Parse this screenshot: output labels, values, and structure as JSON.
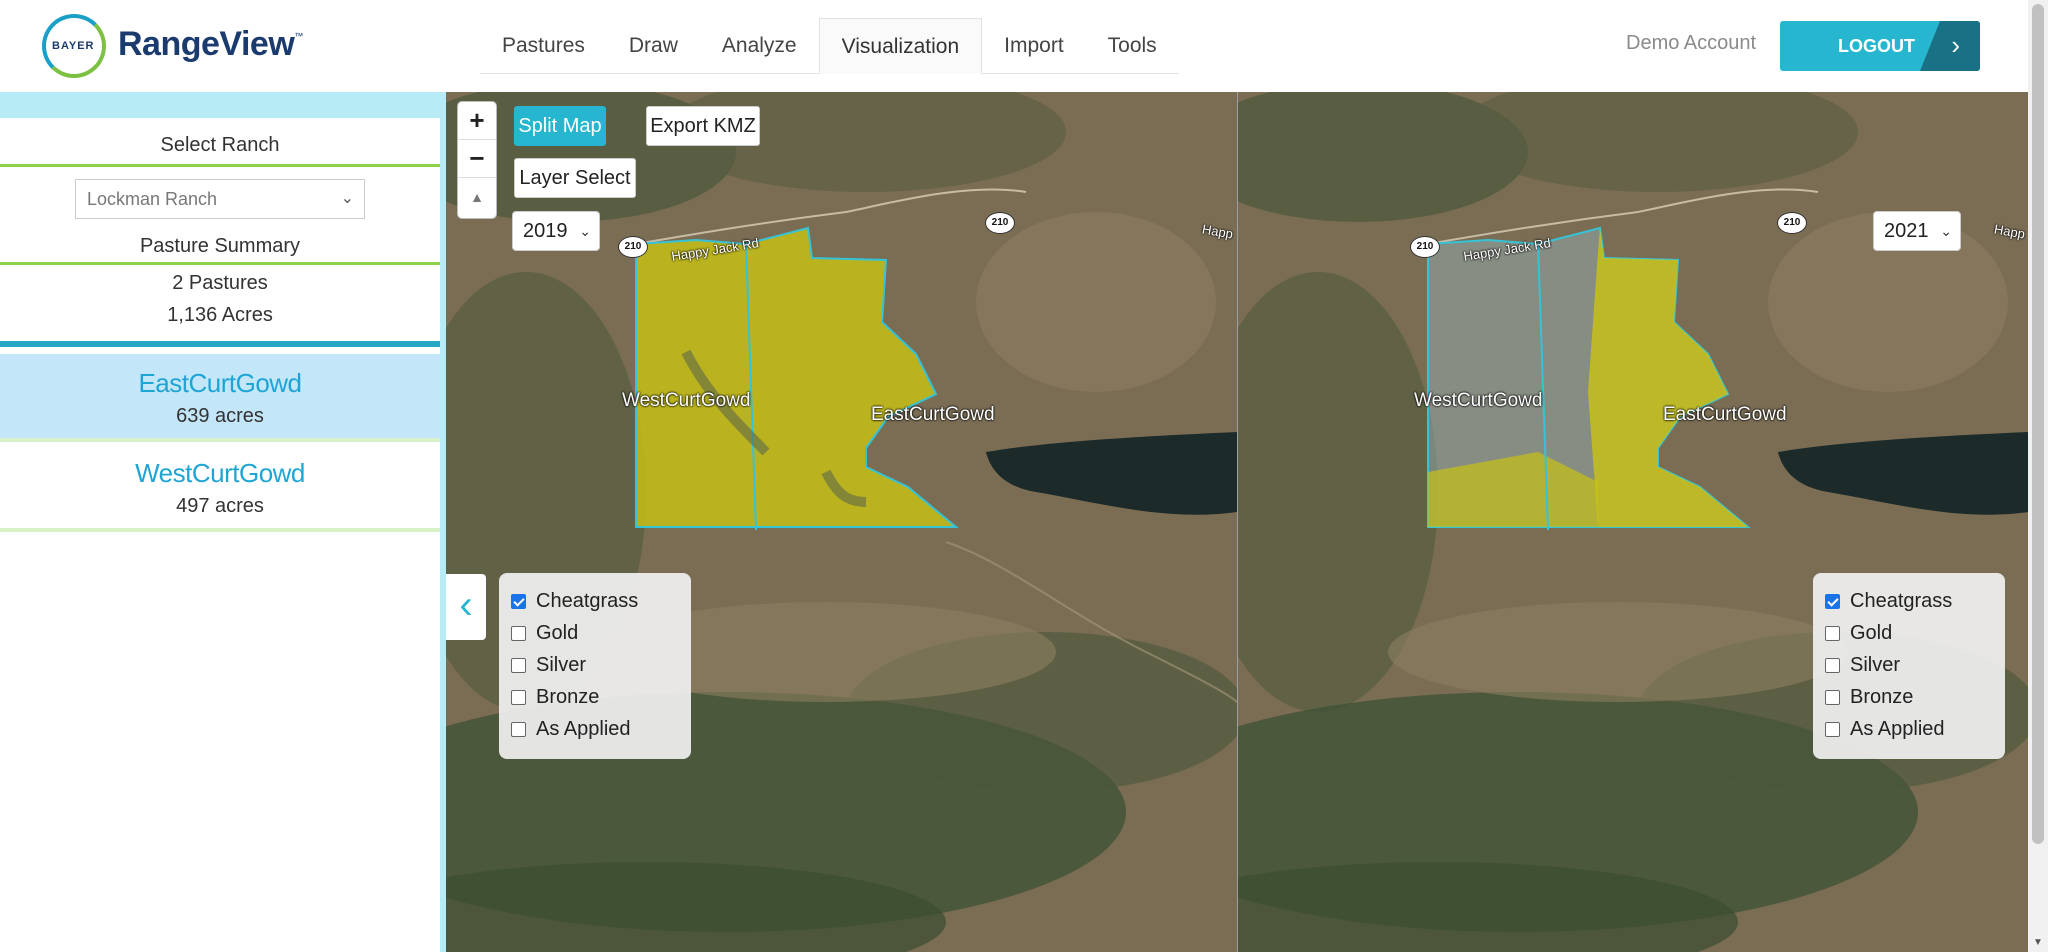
{
  "header": {
    "logo_text": "BAYER",
    "brand": "RangeView",
    "brand_tm": "™",
    "nav": [
      "Pastures",
      "Draw",
      "Analyze",
      "Visualization",
      "Import",
      "Tools"
    ],
    "active_tab": "Visualization",
    "account": "Demo Account",
    "logout": "LOGOUT"
  },
  "sidebar": {
    "select_ranch_label": "Select Ranch",
    "ranch_value": "Lockman Ranch",
    "summary_label": "Pasture Summary",
    "pasture_count": "2 Pastures",
    "total_acres": "1,136 Acres",
    "pastures": [
      {
        "name": "EastCurtGowd",
        "acres": "639 acres",
        "selected": true
      },
      {
        "name": "WestCurtGowd",
        "acres": "497 acres",
        "selected": false
      }
    ]
  },
  "map": {
    "zoom_in": "+",
    "zoom_out": "−",
    "compass": "▲",
    "split_map": "Split Map",
    "export_kmz": "Export KMZ",
    "layer_select": "Layer Select",
    "left_year": "2019",
    "right_year": "2021",
    "collapse": "‹",
    "labels": {
      "west": "WestCurtGowd",
      "east": "EastCurtGowd",
      "road": "Happy Jack Rd",
      "road_right": "Happ",
      "shield": "210"
    },
    "layers": [
      {
        "label": "Cheatgrass",
        "checked": true
      },
      {
        "label": "Gold",
        "checked": false
      },
      {
        "label": "Silver",
        "checked": false
      },
      {
        "label": "Bronze",
        "checked": false
      },
      {
        "label": "As Applied",
        "checked": false
      }
    ],
    "colors": {
      "cheatgrass": "#c8c214",
      "boundary": "#35c3d8",
      "water": "#1c2a2a",
      "accent": "#27b6d0"
    }
  }
}
